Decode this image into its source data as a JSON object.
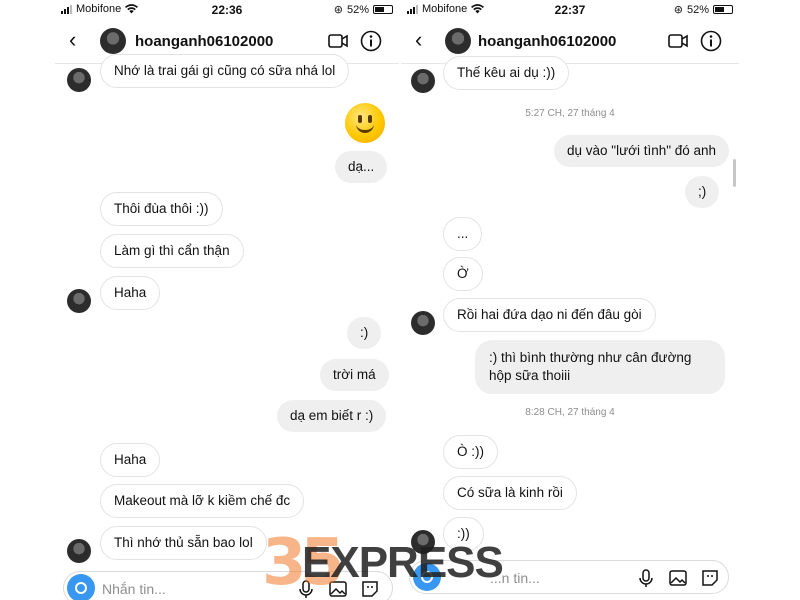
{
  "left": {
    "status": {
      "carrier": "Mobifone",
      "time": "22:36",
      "battery": "52%"
    },
    "header": {
      "username": "hoanganh06102000"
    },
    "messages": [
      "Nhớ là trai gái gì cũng có sữa nhá lol",
      "dạ...",
      "Thôi đùa thôi :))",
      "Làm gì thì cẩn thận",
      "Haha",
      ":)",
      "trời má",
      "dạ em biết r :)",
      "Haha",
      "Makeout mà lỡ k kiềm chế đc",
      "Thì nhớ thủ sẵn bao lol"
    ],
    "composer": {
      "placeholder": "Nhắn tin..."
    }
  },
  "right": {
    "status": {
      "carrier": "Mobifone",
      "time": "22:37",
      "battery": "52%"
    },
    "header": {
      "username": "hoanganh06102000"
    },
    "timestamps": [
      "5:27 CH, 27 tháng 4",
      "8:28 CH, 27 tháng 4"
    ],
    "messages": [
      "Thế kêu ai dụ :))",
      "dụ vào \"lưới tình\" đó anh",
      ";)",
      "...",
      "Ờ",
      "Rồi hai đứa dạo ni đến đâu gòi",
      ":) thì bình thường như cân đường hộp sữa thoiii",
      "Ò :))",
      "Có sữa là kinh rồi",
      ":))"
    ],
    "composer": {
      "placeholder": "...n tin..."
    }
  },
  "watermark": {
    "number": "35",
    "word": "EXPRESS"
  },
  "icons": {
    "back": "chevron-left-icon",
    "video": "video-camera-icon",
    "info": "info-icon",
    "camera": "camera-icon",
    "mic": "microphone-icon",
    "gallery": "image-icon",
    "sticker": "sticker-icon",
    "wifi": "wifi-icon",
    "emoji": "smiling-face-emoji"
  },
  "colors": {
    "accent": "#3897f0",
    "incoming_border": "#e3e3e3",
    "outgoing_bg": "#efefef",
    "timestamp": "#8e8e8e"
  }
}
